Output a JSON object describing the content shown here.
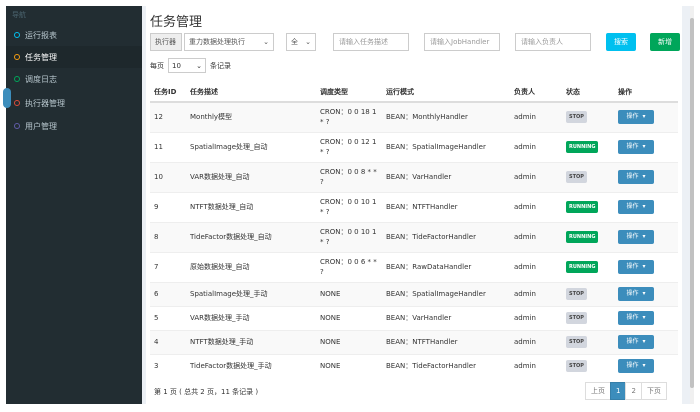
{
  "sidebar": {
    "header": "导航",
    "items": [
      {
        "label": "运行报表"
      },
      {
        "label": "任务管理"
      },
      {
        "label": "调度日志"
      },
      {
        "label": "执行器管理"
      },
      {
        "label": "用户管理"
      }
    ]
  },
  "page": {
    "title": "任务管理"
  },
  "filters": {
    "executor_label": "执行器",
    "executor_value": "重力数据处理执行",
    "status_value": "全",
    "desc_placeholder": "请输入任务描述",
    "handler_placeholder": "请输入JobHandler",
    "author_placeholder": "请输入负责人",
    "search_label": "搜索",
    "add_label": "新增"
  },
  "length": {
    "prefix": "每页",
    "value": "10",
    "suffix": "条记录"
  },
  "table": {
    "headers": [
      "任务ID",
      "任务描述",
      "调度类型",
      "运行模式",
      "负责人",
      "状态",
      "操作"
    ],
    "rows": [
      {
        "id": "12",
        "desc": "Monthly模型",
        "sched": "CRON：0 0 18 1 * ?",
        "mode": "BEAN：MonthlyHandler",
        "author": "admin",
        "status": "STOP",
        "op": "操作"
      },
      {
        "id": "11",
        "desc": "SpatialImage处理_自动",
        "sched": "CRON：0 0 12 1 * ?",
        "mode": "BEAN：SpatialImageHandler",
        "author": "admin",
        "status": "RUNNING",
        "op": "操作"
      },
      {
        "id": "10",
        "desc": "VAR数据处理_自动",
        "sched": "CRON：0 0 8 * * ?",
        "mode": "BEAN：VarHandler",
        "author": "admin",
        "status": "STOP",
        "op": "操作"
      },
      {
        "id": "9",
        "desc": "NTFT数据处理_自动",
        "sched": "CRON：0 0 10 1 * ?",
        "mode": "BEAN：NTFTHandler",
        "author": "admin",
        "status": "RUNNING",
        "op": "操作"
      },
      {
        "id": "8",
        "desc": "TideFactor数据处理_自动",
        "sched": "CRON：0 0 10 1 * ?",
        "mode": "BEAN：TideFactorHandler",
        "author": "admin",
        "status": "RUNNING",
        "op": "操作"
      },
      {
        "id": "7",
        "desc": "原始数据处理_自动",
        "sched": "CRON：0 0 6 * * ?",
        "mode": "BEAN：RawDataHandler",
        "author": "admin",
        "status": "RUNNING",
        "op": "操作"
      },
      {
        "id": "6",
        "desc": "SpatialImage处理_手动",
        "sched": "NONE",
        "mode": "BEAN：SpatialImageHandler",
        "author": "admin",
        "status": "STOP",
        "op": "操作"
      },
      {
        "id": "5",
        "desc": "VAR数据处理_手动",
        "sched": "NONE",
        "mode": "BEAN：VarHandler",
        "author": "admin",
        "status": "STOP",
        "op": "操作"
      },
      {
        "id": "4",
        "desc": "NTFT数据处理_手动",
        "sched": "NONE",
        "mode": "BEAN：NTFTHandler",
        "author": "admin",
        "status": "STOP",
        "op": "操作"
      },
      {
        "id": "3",
        "desc": "TideFactor数据处理_手动",
        "sched": "NONE",
        "mode": "BEAN：TideFactorHandler",
        "author": "admin",
        "status": "STOP",
        "op": "操作"
      }
    ]
  },
  "footer": {
    "info": "第 1 页 ( 总共 2 页，11 条记录 )"
  },
  "pager": {
    "prev": "上页",
    "p1": "1",
    "p2": "2",
    "next": "下页"
  },
  "colors": {
    "sidebar": "#222d32",
    "primary": "#3c8dbc",
    "success": "#00a65a",
    "info": "#00c0ef"
  }
}
